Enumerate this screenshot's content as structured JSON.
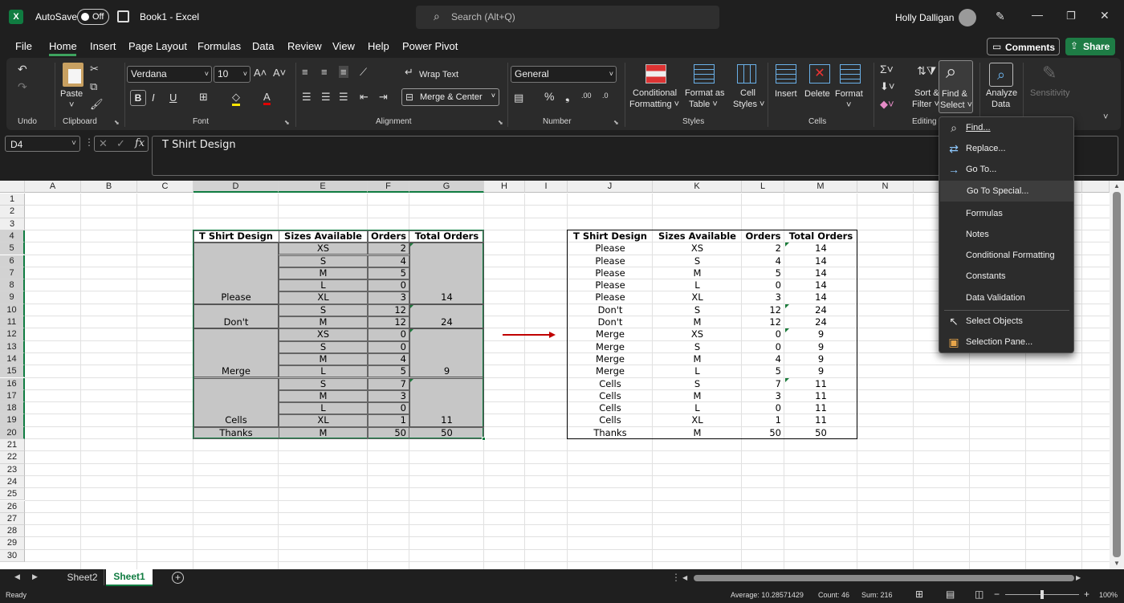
{
  "titlebar": {
    "autosave_label": "AutoSave",
    "autosave_state": "Off",
    "doc_title": "Book1  -  Excel",
    "search_placeholder": "Search (Alt+Q)",
    "user_name": "Holly Dalligan"
  },
  "menu": {
    "tabs": [
      "File",
      "Home",
      "Insert",
      "Page Layout",
      "Formulas",
      "Data",
      "Review",
      "View",
      "Help",
      "Power Pivot"
    ],
    "active": "Home",
    "comments_label": "Comments",
    "share_label": "Share"
  },
  "ribbon": {
    "groups": {
      "undo": "Undo",
      "clipboard": "Clipboard",
      "font": "Font",
      "alignment": "Alignment",
      "number": "Number",
      "styles": "Styles",
      "cells": "Cells",
      "editing": "Editing"
    },
    "paste": "Paste",
    "font_name": "Verdana",
    "font_size": "10",
    "wrap_text": "Wrap Text",
    "merge_center": "Merge & Center",
    "number_format": "General",
    "cond_fmt": [
      "Conditional",
      "Formatting ˅"
    ],
    "fmt_table": [
      "Format as",
      "Table ˅"
    ],
    "cell_styles": [
      "Cell",
      "Styles ˅"
    ],
    "insert": "Insert",
    "delete": "Delete",
    "format": "Format",
    "sort_filter": [
      "Sort &",
      "Filter ˅"
    ],
    "find_select": [
      "Find &",
      "Select ˅"
    ],
    "analyze": [
      "Analyze",
      "Data"
    ],
    "sensitivity": "Sensitivity"
  },
  "formula": {
    "name_box": "D4",
    "value": "T Shirt Design"
  },
  "find_menu": {
    "items": [
      "Find...",
      "Replace...",
      "Go To...",
      "Go To Special...",
      "Formulas",
      "Notes",
      "Conditional Formatting",
      "Constants",
      "Data Validation",
      "Select Objects",
      "Selection Pane..."
    ]
  },
  "columns": [
    "A",
    "B",
    "C",
    "D",
    "E",
    "F",
    "G",
    "H",
    "I",
    "J",
    "K",
    "L",
    "M",
    "N"
  ],
  "rows": [
    "1",
    "2",
    "3",
    "4",
    "5",
    "6",
    "7",
    "8",
    "9",
    "10",
    "11",
    "12",
    "13",
    "14",
    "15",
    "16",
    "17",
    "18",
    "19",
    "20",
    "21",
    "22",
    "23",
    "24",
    "25",
    "26",
    "27",
    "28",
    "29",
    "30"
  ],
  "left_table": {
    "headers": [
      "T Shirt Design",
      "Sizes Available",
      "Orders",
      "Total Orders"
    ],
    "sizes": [
      "XS",
      "S",
      "M",
      "L",
      "XL",
      "S",
      "M",
      "XS",
      "S",
      "M",
      "L",
      "S",
      "M",
      "L",
      "XL",
      "M"
    ],
    "orders": [
      "2",
      "4",
      "5",
      "0",
      "3",
      "12",
      "12",
      "0",
      "0",
      "4",
      "5",
      "7",
      "3",
      "0",
      "1",
      "50"
    ],
    "designs": [
      {
        "row": 9,
        "name": "Please",
        "total": "14"
      },
      {
        "row": 11,
        "name": "Don't",
        "total": "24"
      },
      {
        "row": 15,
        "name": "Merge",
        "total": "9"
      },
      {
        "row": 19,
        "name": "Cells",
        "total": "11"
      },
      {
        "row": 20,
        "name": "Thanks",
        "total": "50"
      }
    ]
  },
  "right_table": {
    "headers": [
      "T Shirt Design",
      "Sizes Available",
      "Orders",
      "Total Orders"
    ],
    "rows": [
      [
        "Please",
        "XS",
        "2",
        "14"
      ],
      [
        "Please",
        "S",
        "4",
        "14"
      ],
      [
        "Please",
        "M",
        "5",
        "14"
      ],
      [
        "Please",
        "L",
        "0",
        "14"
      ],
      [
        "Please",
        "XL",
        "3",
        "14"
      ],
      [
        "Don't",
        "S",
        "12",
        "24"
      ],
      [
        "Don't",
        "M",
        "12",
        "24"
      ],
      [
        "Merge",
        "XS",
        "0",
        "9"
      ],
      [
        "Merge",
        "S",
        "0",
        "9"
      ],
      [
        "Merge",
        "M",
        "4",
        "9"
      ],
      [
        "Merge",
        "L",
        "5",
        "9"
      ],
      [
        "Cells",
        "S",
        "7",
        "11"
      ],
      [
        "Cells",
        "M",
        "3",
        "11"
      ],
      [
        "Cells",
        "L",
        "0",
        "11"
      ],
      [
        "Cells",
        "XL",
        "1",
        "11"
      ],
      [
        "Thanks",
        "M",
        "50",
        "50"
      ]
    ]
  },
  "sheets": {
    "tabs": [
      "Sheet2",
      "Sheet1"
    ],
    "active": "Sheet1"
  },
  "status": {
    "ready": "Ready",
    "average": "Average: 10.28571429",
    "count": "Count: 46",
    "sum": "Sum: 216",
    "zoom": "100%"
  },
  "colors": {
    "excel_green": "#107c41",
    "share_green": "#1e7c45",
    "selection_fill": "#c6c6c6",
    "arrow_red": "#c00000"
  }
}
